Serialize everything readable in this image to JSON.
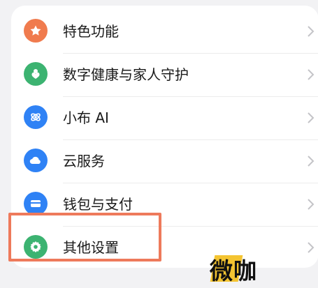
{
  "menu": {
    "items": [
      {
        "label": "特色功能",
        "icon": "star-icon",
        "color": "#f07b4e"
      },
      {
        "label": "数字健康与家人守护",
        "icon": "heart-person-icon",
        "color": "#3cb371"
      },
      {
        "label": "小布 AI",
        "icon": "xiaobu-ai-icon",
        "color": "#2f82f5"
      },
      {
        "label": "云服务",
        "icon": "cloud-icon",
        "color": "#2f82f5"
      },
      {
        "label": "钱包与支付",
        "icon": "wallet-icon",
        "color": "#2f82f5"
      },
      {
        "label": "其他设置",
        "icon": "gear-icon",
        "color": "#3cb371"
      }
    ],
    "chevron": "›"
  },
  "highlight_color": "#ee7a5b",
  "watermark": {
    "text": "微咖"
  }
}
